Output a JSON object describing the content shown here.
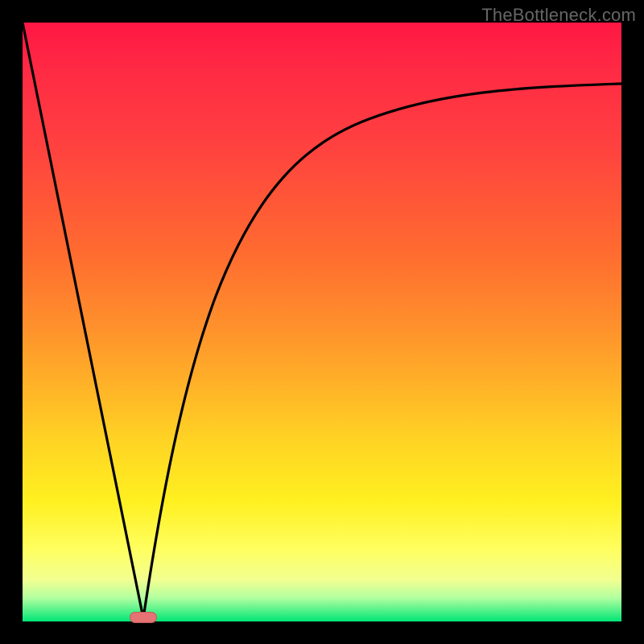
{
  "watermark": "TheBottleneck.com",
  "colors": {
    "frame": "#000000",
    "marker_fill": "#e57373",
    "marker_border": "#c25b5b",
    "curve": "#000000",
    "gradient_top": "#ff1744",
    "gradient_bottom": "#00e676"
  },
  "chart_data": {
    "type": "line",
    "title": "",
    "xlabel": "",
    "ylabel": "",
    "xlim": [
      0,
      100
    ],
    "ylim": [
      0,
      100
    ],
    "grid": false,
    "annotations": [
      "marker at minimum"
    ],
    "series": [
      {
        "name": "left-descending-line",
        "x": [
          0,
          20
        ],
        "values": [
          100,
          0
        ]
      },
      {
        "name": "right-growth-curve",
        "x": [
          20,
          25,
          30,
          35,
          40,
          45,
          50,
          55,
          60,
          65,
          70,
          75,
          80,
          85,
          90,
          95,
          100
        ],
        "values": [
          0,
          26,
          44,
          56,
          64,
          70,
          74,
          77,
          80,
          82,
          84,
          85.5,
          86.7,
          87.7,
          88.5,
          89.2,
          89.8
        ]
      }
    ],
    "marker": {
      "x": 20,
      "y": 0
    }
  }
}
